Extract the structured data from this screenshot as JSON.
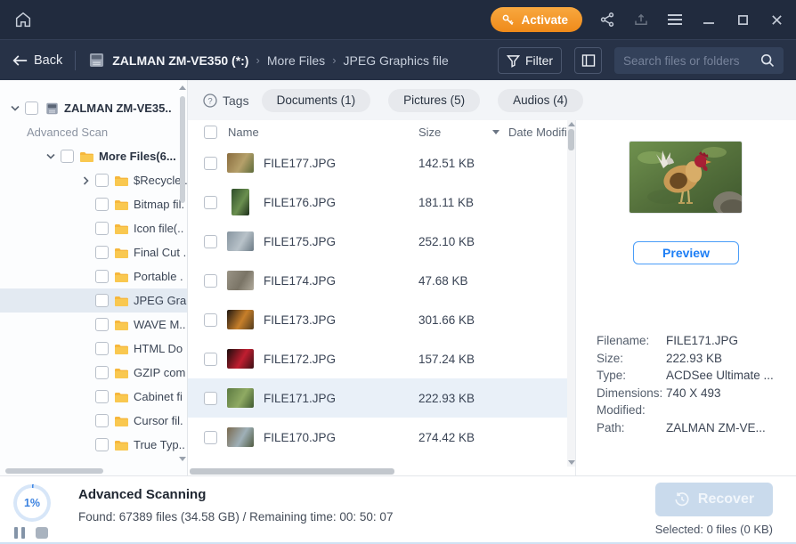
{
  "titlebar": {
    "activate_label": "Activate"
  },
  "navbar": {
    "back_label": "Back",
    "separator": "›",
    "breadcrumb": [
      "ZALMAN  ZM-VE350  (*:)",
      "More Files",
      "JPEG Graphics file"
    ],
    "filter_label": "Filter",
    "search_placeholder": "Search files or folders"
  },
  "sidebar": {
    "items": [
      {
        "label": "ZALMAN  ZM-VE35.."
      },
      {
        "label": "Advanced Scan"
      },
      {
        "label": "More Files(6..."
      },
      {
        "label": "$Recycle.."
      },
      {
        "label": "Bitmap fil."
      },
      {
        "label": "Icon file(.."
      },
      {
        "label": "Final Cut ."
      },
      {
        "label": "Portable ."
      },
      {
        "label": "JPEG Gra."
      },
      {
        "label": "WAVE M.."
      },
      {
        "label": "HTML Do"
      },
      {
        "label": "GZIP com"
      },
      {
        "label": "Cabinet fi"
      },
      {
        "label": "Cursor fil."
      },
      {
        "label": "True Typ.."
      }
    ]
  },
  "tags": {
    "label": "Tags",
    "pills": [
      "Documents (1)",
      "Pictures (5)",
      "Audios (4)"
    ]
  },
  "list": {
    "columns": {
      "name": "Name",
      "size": "Size",
      "date": "Date Modifi"
    },
    "files": [
      {
        "name": "FILE177.JPG",
        "size": "142.51 KB",
        "thumb": [
          "#8a6d3f",
          "#b5a06a",
          "#5d6b3a"
        ]
      },
      {
        "name": "FILE176.JPG",
        "size": "181.11 KB",
        "thumb": [
          "#2e4d2a",
          "#6a8f4f",
          "#1d2f1a"
        ],
        "portrait": true
      },
      {
        "name": "FILE175.JPG",
        "size": "252.10 KB",
        "thumb": [
          "#8795a0",
          "#b8c2c9",
          "#6b7a85"
        ]
      },
      {
        "name": "FILE174.JPG",
        "size": "47.68 KB",
        "thumb": [
          "#9a9486",
          "#7a7466",
          "#b0aa9c"
        ]
      },
      {
        "name": "FILE173.JPG",
        "size": "301.66 KB",
        "thumb": [
          "#201812",
          "#c77f2a",
          "#513a1c"
        ]
      },
      {
        "name": "FILE172.JPG",
        "size": "157.24 KB",
        "thumb": [
          "#1a0c0c",
          "#c01e30",
          "#3a0f14"
        ]
      },
      {
        "name": "FILE171.JPG",
        "size": "222.93 KB",
        "thumb": [
          "#5d7a42",
          "#8faa63",
          "#3f5a30"
        ]
      },
      {
        "name": "FILE170.JPG",
        "size": "274.42 KB",
        "thumb": [
          "#7a6a4f",
          "#9fb0b8",
          "#4f5a40"
        ]
      }
    ]
  },
  "preview": {
    "button_label": "Preview",
    "details": [
      {
        "label": "Filename:",
        "value": "FILE171.JPG"
      },
      {
        "label": "Size:",
        "value": "222.93 KB"
      },
      {
        "label": "Type:",
        "value": "ACDSee Ultimate ..."
      },
      {
        "label": "Dimensions:",
        "value": "740 X 493"
      },
      {
        "label": "Modified:",
        "value": ""
      },
      {
        "label": "Path:",
        "value": "ZALMAN  ZM-VE..."
      }
    ]
  },
  "footer": {
    "progress": "1%",
    "status_title": "Advanced Scanning",
    "status_detail": "Found: 67389 files (34.58 GB) / Remaining time: 00: 50: 07",
    "recover_label": "Recover",
    "selected_label": "Selected: 0 files (0 KB)"
  },
  "colors": {
    "accent_orange": "#f09423",
    "accent_blue": "#1d7ef5",
    "titlebar_bg": "#212b3e",
    "navbar_bg": "#273247",
    "selected_row_bg": "#e9f0f8",
    "folder_yellow": "#f6b73c"
  }
}
